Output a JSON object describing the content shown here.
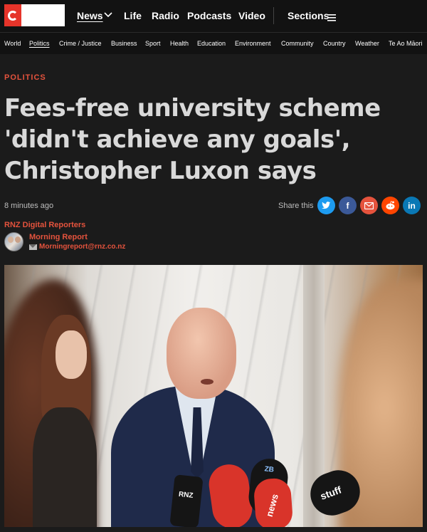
{
  "nav": {
    "items": [
      "News",
      "Life",
      "Radio",
      "Podcasts",
      "Video"
    ],
    "sections_label": "Sections"
  },
  "subnav": {
    "items": [
      "World",
      "Politics",
      "Crime / Justice",
      "Business",
      "Sport",
      "Health",
      "Education",
      "Environment",
      "Community",
      "Country",
      "Weather",
      "Te Ao Māori"
    ],
    "active": "Politics"
  },
  "article": {
    "kicker": "POLITICS",
    "headline": "Fees-free university scheme 'didn't achieve any goals', Christopher Luxon says",
    "timestamp": "8 minutes ago",
    "share_label": "Share this",
    "byline_org": "RNZ Digital Reporters",
    "author_name": "Morning Report",
    "author_email": "Morningreport@rnz.co.nz"
  },
  "share_buttons": [
    {
      "name": "twitter",
      "glyph": "t",
      "color": "#1d9bf0"
    },
    {
      "name": "facebook",
      "glyph": "f",
      "color": "#3b5998"
    },
    {
      "name": "email",
      "glyph": "✉",
      "color": "#e5533d"
    },
    {
      "name": "reddit",
      "glyph": "r",
      "color": "#ff4500"
    },
    {
      "name": "linkedin",
      "glyph": "in",
      "color": "#0a78b5"
    }
  ],
  "photo_text": {
    "mic_rnz": "RNZ",
    "mic_news": "news",
    "mic_stuff": "stuff",
    "mic_zb": "ZB"
  }
}
